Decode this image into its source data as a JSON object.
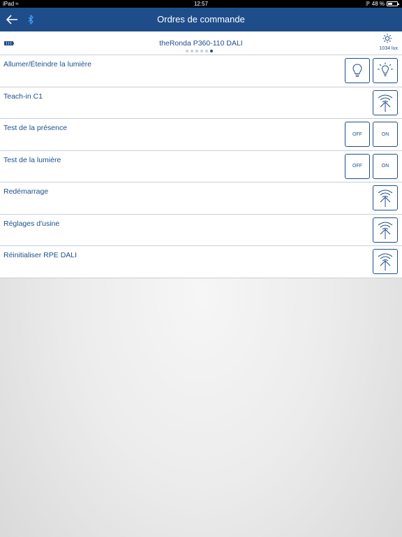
{
  "status_bar": {
    "device": "iPad",
    "time": "12:57",
    "battery": "48 %"
  },
  "nav": {
    "title": "Ordres de commande"
  },
  "device_bar": {
    "name": "theRonda P360-110 DALI",
    "lux": "1034 lux",
    "page_count": 6,
    "active_page": 6
  },
  "commands": [
    {
      "label": "Allumer/Éteindre la lumière"
    },
    {
      "label": "Teach-in C1"
    },
    {
      "label": "Test de la présence",
      "off": "OFF",
      "on": "ON"
    },
    {
      "label": "Test de la lumière",
      "off": "OFF",
      "on": "ON"
    },
    {
      "label": "Redémarrage"
    },
    {
      "label": "Réglages d'usine"
    },
    {
      "label": "Réinitialiser RPE DALI"
    }
  ],
  "colors": {
    "primary": "#1f4d8a",
    "divider": "#c8ced8"
  },
  "icons": [
    "back-arrow-icon",
    "bluetooth-icon",
    "battery-icon",
    "sun-icon",
    "bulb-off-icon",
    "bulb-on-icon",
    "send-signal-icon"
  ]
}
